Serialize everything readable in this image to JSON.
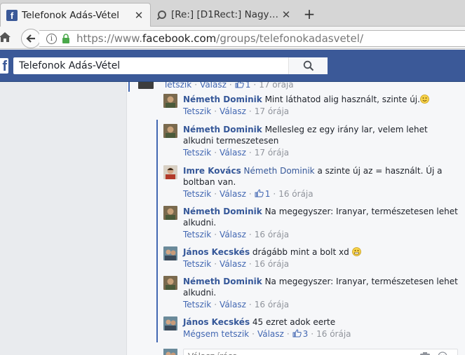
{
  "browser": {
    "tabs": [
      {
        "title": "Telefonok Adás-Vétel",
        "active": true
      },
      {
        "title": "[Re:] [D1Rect:] Nagy…",
        "active": false
      }
    ],
    "url_prefix": "https://www.",
    "url_domain": "facebook.com",
    "url_path": "/groups/telefonokadasvetel/"
  },
  "fb": {
    "logo": "f",
    "search_value": "Telefonok Adás-Vétel"
  },
  "top_partial": {
    "like_label": "Tetszik",
    "reply_label": "Válasz",
    "like_count": "1",
    "time": "17 órája"
  },
  "comments": [
    {
      "author": "Németh Dominik",
      "mention": "",
      "text": "Mint láthatod alig használt, szinte új.",
      "smiley": "smile",
      "like_label": "Tetszik",
      "reply_label": "Válasz",
      "likes": "",
      "time": "17 órája"
    },
    {
      "author": "Németh Dominik",
      "mention": "",
      "text": "Mellesleg ez egy irány lar, velem lehet alkudni termeszetesen",
      "smiley": "",
      "like_label": "Tetszik",
      "reply_label": "Válasz",
      "likes": "",
      "time": "17 órája"
    },
    {
      "author": "Imre Kovács",
      "mention": "Németh Dominik",
      "text": "a szinte új az = használt. Új a boltban van.",
      "smiley": "",
      "like_label": "Tetszik",
      "reply_label": "Válasz",
      "likes": "1",
      "time": "16 órája"
    },
    {
      "author": "Németh Dominik",
      "mention": "",
      "text": "Na megegyszer: Iranyar, természetesen lehet alkudni.",
      "smiley": "",
      "like_label": "Tetszik",
      "reply_label": "Válasz",
      "likes": "",
      "time": "16 órája"
    },
    {
      "author": "János Kecskés",
      "mention": "",
      "text": "drágább mint a bolt xd",
      "smiley": "grin",
      "like_label": "Tetszik",
      "reply_label": "Válasz",
      "likes": "",
      "time": "16 órája"
    },
    {
      "author": "Németh Dominik",
      "mention": "",
      "text": "Na megegyszer: Iranyar, természetesen lehet alkudni.",
      "smiley": "",
      "like_label": "Tetszik",
      "reply_label": "Válasz",
      "likes": "",
      "time": "16 órája"
    },
    {
      "author": "János Kecskés",
      "mention": "",
      "text": "45 ezret adok eerte",
      "smiley": "",
      "like_label": "Mégsem tetszik",
      "reply_label": "Válasz",
      "likes": "3",
      "time": "16 órája"
    }
  ],
  "reply_box": {
    "placeholder": "Válasz írása..."
  },
  "colors": {
    "fb_blue": "#3b5998",
    "link_blue": "#365899",
    "meta_gray": "#90949c"
  }
}
